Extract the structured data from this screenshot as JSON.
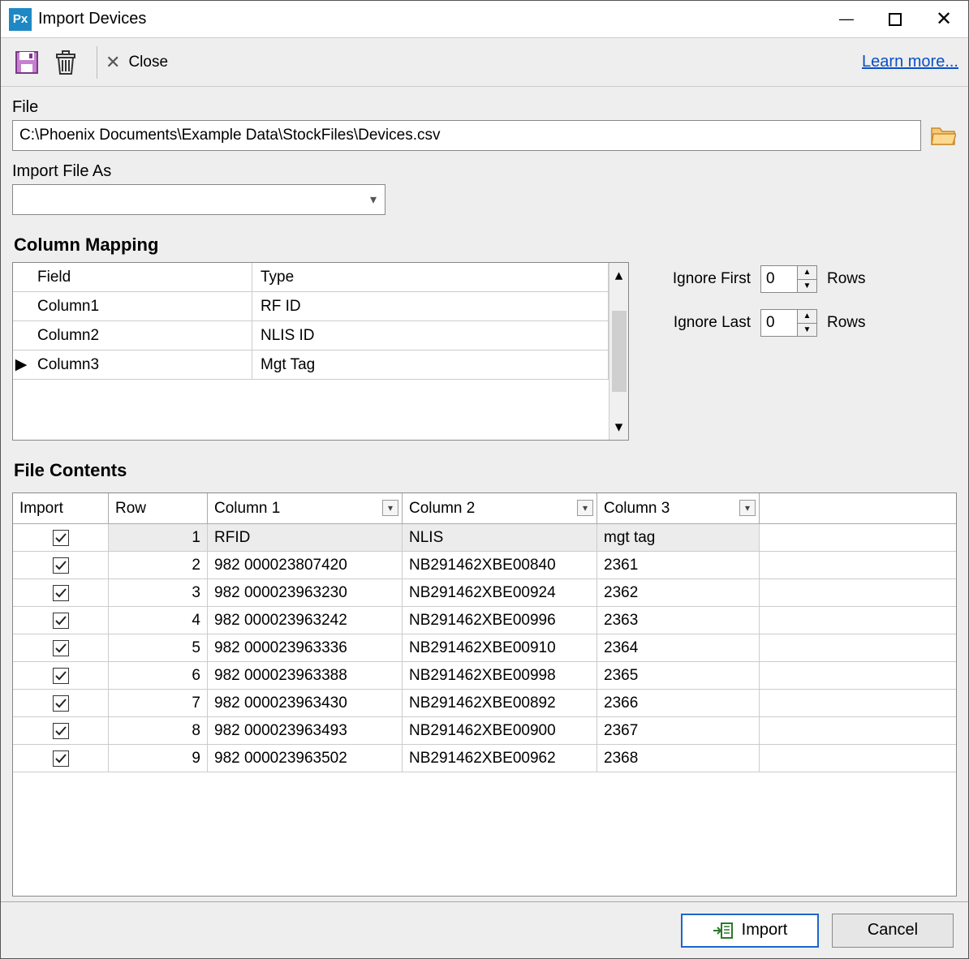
{
  "window": {
    "title": "Import Devices",
    "app_abbrev": "Px"
  },
  "toolbar": {
    "close_label": "Close",
    "learn_more": "Learn more..."
  },
  "file": {
    "label": "File",
    "path": "C:\\Phoenix Documents\\Example Data\\StockFiles\\Devices.csv"
  },
  "import_as": {
    "label": "Import File As",
    "value": ""
  },
  "mapping": {
    "title": "Column Mapping",
    "headers": {
      "field": "Field",
      "type": "Type"
    },
    "rows": [
      {
        "field": "Column1",
        "type": "RF ID",
        "selected": false
      },
      {
        "field": "Column2",
        "type": "NLIS ID",
        "selected": false
      },
      {
        "field": "Column3",
        "type": "Mgt Tag",
        "selected": true
      }
    ]
  },
  "ignore": {
    "first_label": "Ignore First",
    "last_label": "Ignore Last",
    "rows_label": "Rows",
    "first_value": "0",
    "last_value": "0"
  },
  "contents": {
    "title": "File Contents",
    "headers": {
      "import": "Import",
      "row": "Row",
      "c1": "Column 1",
      "c2": "Column 2",
      "c3": "Column 3"
    },
    "rows": [
      {
        "import": true,
        "row": "1",
        "c1": "RFID",
        "c2": "NLIS",
        "c3": "mgt tag",
        "selected": true
      },
      {
        "import": true,
        "row": "2",
        "c1": "982 000023807420",
        "c2": "NB291462XBE00840",
        "c3": "2361",
        "selected": false
      },
      {
        "import": true,
        "row": "3",
        "c1": "982 000023963230",
        "c2": "NB291462XBE00924",
        "c3": "2362",
        "selected": false
      },
      {
        "import": true,
        "row": "4",
        "c1": "982 000023963242",
        "c2": "NB291462XBE00996",
        "c3": "2363",
        "selected": false
      },
      {
        "import": true,
        "row": "5",
        "c1": "982 000023963336",
        "c2": "NB291462XBE00910",
        "c3": "2364",
        "selected": false
      },
      {
        "import": true,
        "row": "6",
        "c1": "982 000023963388",
        "c2": "NB291462XBE00998",
        "c3": "2365",
        "selected": false
      },
      {
        "import": true,
        "row": "7",
        "c1": "982 000023963430",
        "c2": "NB291462XBE00892",
        "c3": "2366",
        "selected": false
      },
      {
        "import": true,
        "row": "8",
        "c1": "982 000023963493",
        "c2": "NB291462XBE00900",
        "c3": "2367",
        "selected": false
      },
      {
        "import": true,
        "row": "9",
        "c1": "982 000023963502",
        "c2": "NB291462XBE00962",
        "c3": "2368",
        "selected": false
      }
    ]
  },
  "footer": {
    "import": "Import",
    "cancel": "Cancel"
  }
}
